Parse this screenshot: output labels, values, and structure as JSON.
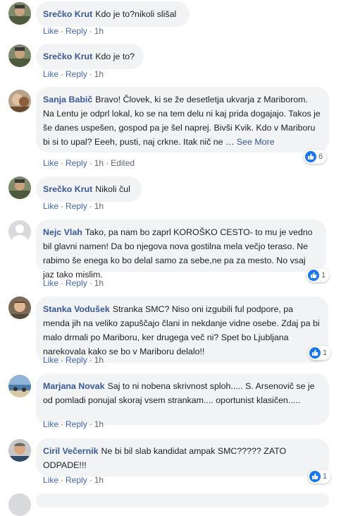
{
  "actions": {
    "like": "Like",
    "reply": "Reply"
  },
  "comments": [
    {
      "author": "Srečko Krut",
      "text": "Kdo je to?nikoli slišal",
      "time": "1h",
      "edited": "",
      "see_more": "",
      "reactions": ""
    },
    {
      "author": "Srečko Krut",
      "text": "Kdo je to?",
      "time": "1h",
      "edited": "",
      "see_more": "",
      "reactions": ""
    },
    {
      "author": "Sanja Babič",
      "text": "Bravo! Človek, ki se že desetletja ukvarja z Mariborom. Na Lentu je odprl lokal, ko se na tem delu ni kaj prida dogajajo. Takos je še danes uspešen, gospod pa je šel naprej. Bivši Kvik. Kdo v Mariboru bi si to upal? Eeeh, pusti, naj crkne. Itak nič ne …",
      "see_more": "See More",
      "time": "1h",
      "edited": "Edited",
      "reactions": "6"
    },
    {
      "author": "Srečko Krut",
      "text": "Nikoli čul",
      "time": "1h",
      "edited": "",
      "see_more": "",
      "reactions": ""
    },
    {
      "author": "Nejc Vlah",
      "text": "Tako, pa nam bo zaprl KOROŠKO CESTO- to mu je vedno bil glavni namen! Da bo njegova nova gostilna mela večjo teraso. Ne rabimo še enega ko bo delal samo za sebe,ne pa za mesto. No vsaj jaz tako mislim.",
      "time": "1h",
      "edited": "",
      "see_more": "",
      "reactions": "1"
    },
    {
      "author": "Stanka Vodušek",
      "text": "Stranka SMC? Niso oni izgubili ful podpore, pa menda jih na veliko zapuščajo člani in nekdanje vidne osebe. Zdaj pa bi malo drmali po Mariboru, ker drugega več ni? Spet bo Ljubljana narekovala kako se bo v Mariboru delalo!!",
      "time": "1h",
      "edited": "",
      "see_more": "",
      "reactions": "1"
    },
    {
      "author": "Marjana Novak",
      "text": "Saj to ni nobena skrivnost sploh..... S. Arsenovič se je od pomladi ponujal skoraj vsem strankam.... oportunist klasičen.....",
      "time": "1h",
      "edited": "",
      "see_more": "",
      "reactions": ""
    },
    {
      "author": "Ciril Večernik",
      "text": "Ne bi bil slab kandidat ampak SMC????? ZATO ODPADE!!!",
      "time": "1h",
      "edited": "",
      "see_more": "",
      "reactions": "1"
    }
  ]
}
